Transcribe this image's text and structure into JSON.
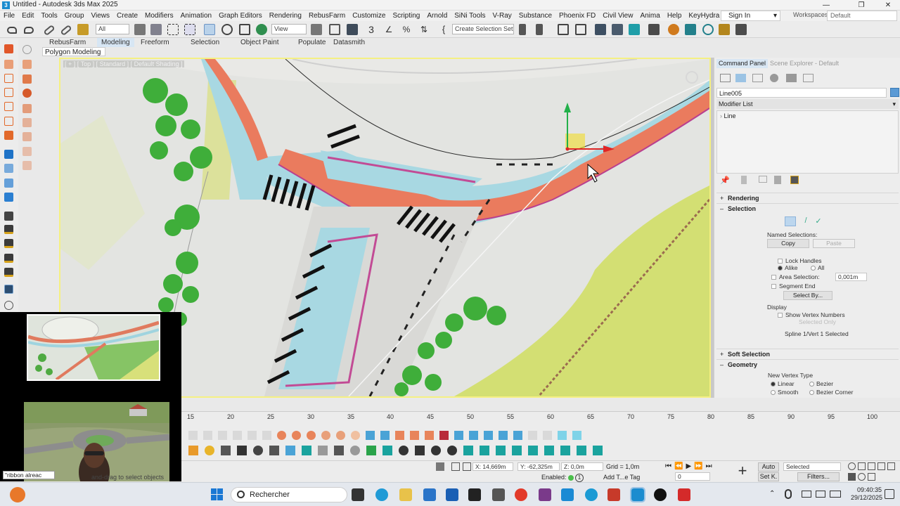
{
  "window": {
    "title": "Untitled - Autodesk 3ds Max 2025",
    "minimize": "—",
    "restore": "❐",
    "close": "✕"
  },
  "menu": [
    "File",
    "Edit",
    "Tools",
    "Group",
    "Views",
    "Create",
    "Modifiers",
    "Animation",
    "Graph Editors",
    "Rendering",
    "RebusFarm",
    "Customize",
    "Scripting",
    "Arnold",
    "SiNi Tools",
    "V-Ray",
    "Substance",
    "Phoenix FD",
    "Civil View",
    "Anima",
    "Help",
    "KeyHydra",
    "»"
  ],
  "account": {
    "sign_in": "Sign In",
    "workspaces_label": "Workspaces:",
    "workspace": "Default"
  },
  "toolbar": {
    "filter_select": "All",
    "view_select": "View",
    "selection_set": "Create Selection Set"
  },
  "ribbon": {
    "tabs": [
      "RebusFarm",
      "Modeling",
      "Freeform",
      "Selection",
      "Object Paint",
      "Populate",
      "Datasmith"
    ],
    "active": "Modeling",
    "subpanel": "Polygon Modeling"
  },
  "viewport": {
    "label": "[ + ] [ Top ] [ Standard ] [ Default Shading ]"
  },
  "command_panel": {
    "tabs": [
      "Command Panel",
      "Scene Explorer - Default"
    ],
    "object_name": "Line005",
    "modifier_list": "Modifier List",
    "stack_item": "Line",
    "sections": {
      "rendering": "Rendering",
      "selection": "Selection",
      "soft_selection": "Soft Selection",
      "geometry": "Geometry"
    },
    "named_selections": "Named Selections:",
    "copy": "Copy",
    "paste": "Paste",
    "lock_handles": "Lock Handles",
    "alike": "Alike",
    "all": "All",
    "area_selection": "Area Selection:",
    "area_value": "0,001m",
    "segment_end": "Segment End",
    "select_by": "Select By...",
    "display": "Display",
    "show_vertex_numbers": "Show Vertex Numbers",
    "selected_only": "Selected Only",
    "status": "Spline 1/Vert 1 Selected",
    "new_vertex_type": "New Vertex Type",
    "vertex_types": [
      "Linear",
      "Bezier",
      "Smooth",
      "Bezier Corner"
    ]
  },
  "timeline": {
    "ticks": [
      "15",
      "20",
      "25",
      "30",
      "35",
      "40",
      "45",
      "50",
      "55",
      "60",
      "65",
      "70",
      "75",
      "80",
      "85",
      "90",
      "95",
      "100"
    ]
  },
  "status": {
    "x": "X: 14,669m",
    "y": "Y: -62,325m",
    "z": "Z: 0,0m",
    "grid": "Grid = 1,0m",
    "enabled": "Enabled:",
    "add_time_tag": "Add T...e Tag",
    "auto": "Auto",
    "set_key": "Set K.",
    "selected": "Selected",
    "filters": "Filters...",
    "frame": "0",
    "prompt": "\"ribbon alreac",
    "prompt_message": "and-drag to select objects"
  },
  "taskbar": {
    "search": "Rechercher",
    "time": "09:40:35",
    "date": "29/12/2025"
  },
  "colors": {
    "accent": "#1b8ccf",
    "viewport_border": "#f5f082",
    "road": "#ea7b5e",
    "water": "#9fd4df",
    "grass": "#d7e27a",
    "tree": "#3fae3a"
  }
}
